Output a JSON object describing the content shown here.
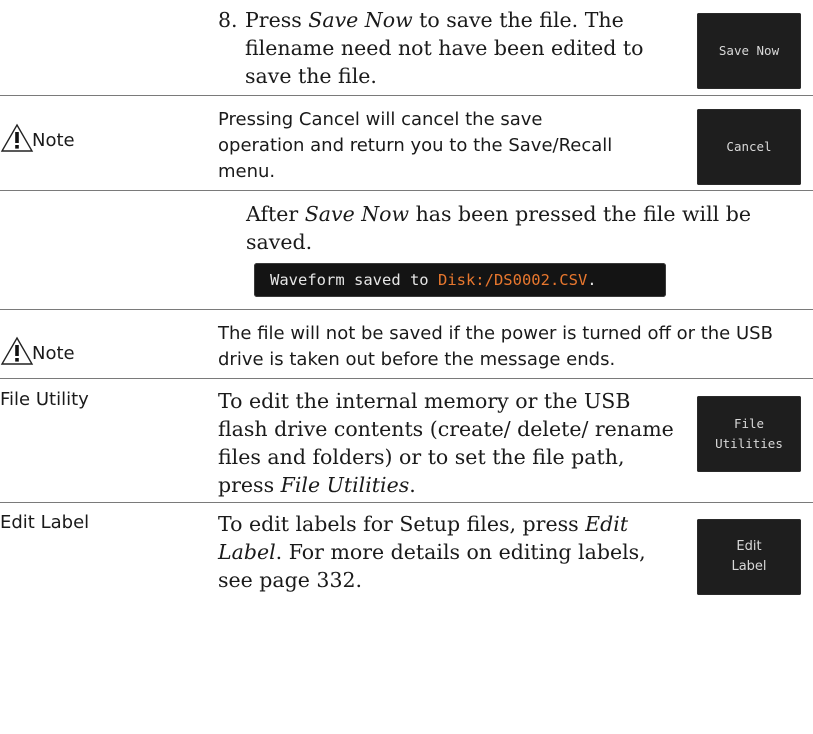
{
  "step8": {
    "number": "8.",
    "pre": "Press ",
    "em": "Save Now",
    "post": " to save the file. The filename need not have been edited to save the file.",
    "button": "Save Now"
  },
  "note1": {
    "label": "Note",
    "text": "Pressing Cancel will cancel the save operation and return you to the Save/Recall menu.",
    "button": "Cancel"
  },
  "after": {
    "pre": "After ",
    "em": "Save Now",
    "post": " has been pressed the file will be saved."
  },
  "message": {
    "text": "Waveform saved to ",
    "path": "Disk:/DS0002.CSV",
    "end": "."
  },
  "note2": {
    "label": "Note",
    "text": "The file will not be saved if the power is turned off or the USB drive is taken out before the message ends."
  },
  "file_utility": {
    "heading": "File Utility",
    "pre": "To edit the internal memory or the USB flash drive contents (create/ delete/ rename files and folders) or to set the file path, press ",
    "em": "File Utilities",
    "post": ".",
    "button_line1": "File",
    "button_line2": "Utilities"
  },
  "edit_label": {
    "heading": "Edit Label",
    "pre": "To edit labels for Setup files, press ",
    "em": "Edit Label",
    "post": ". For more details on editing labels, see page 332.",
    "button_line1": "Edit",
    "button_line2": "Label"
  }
}
